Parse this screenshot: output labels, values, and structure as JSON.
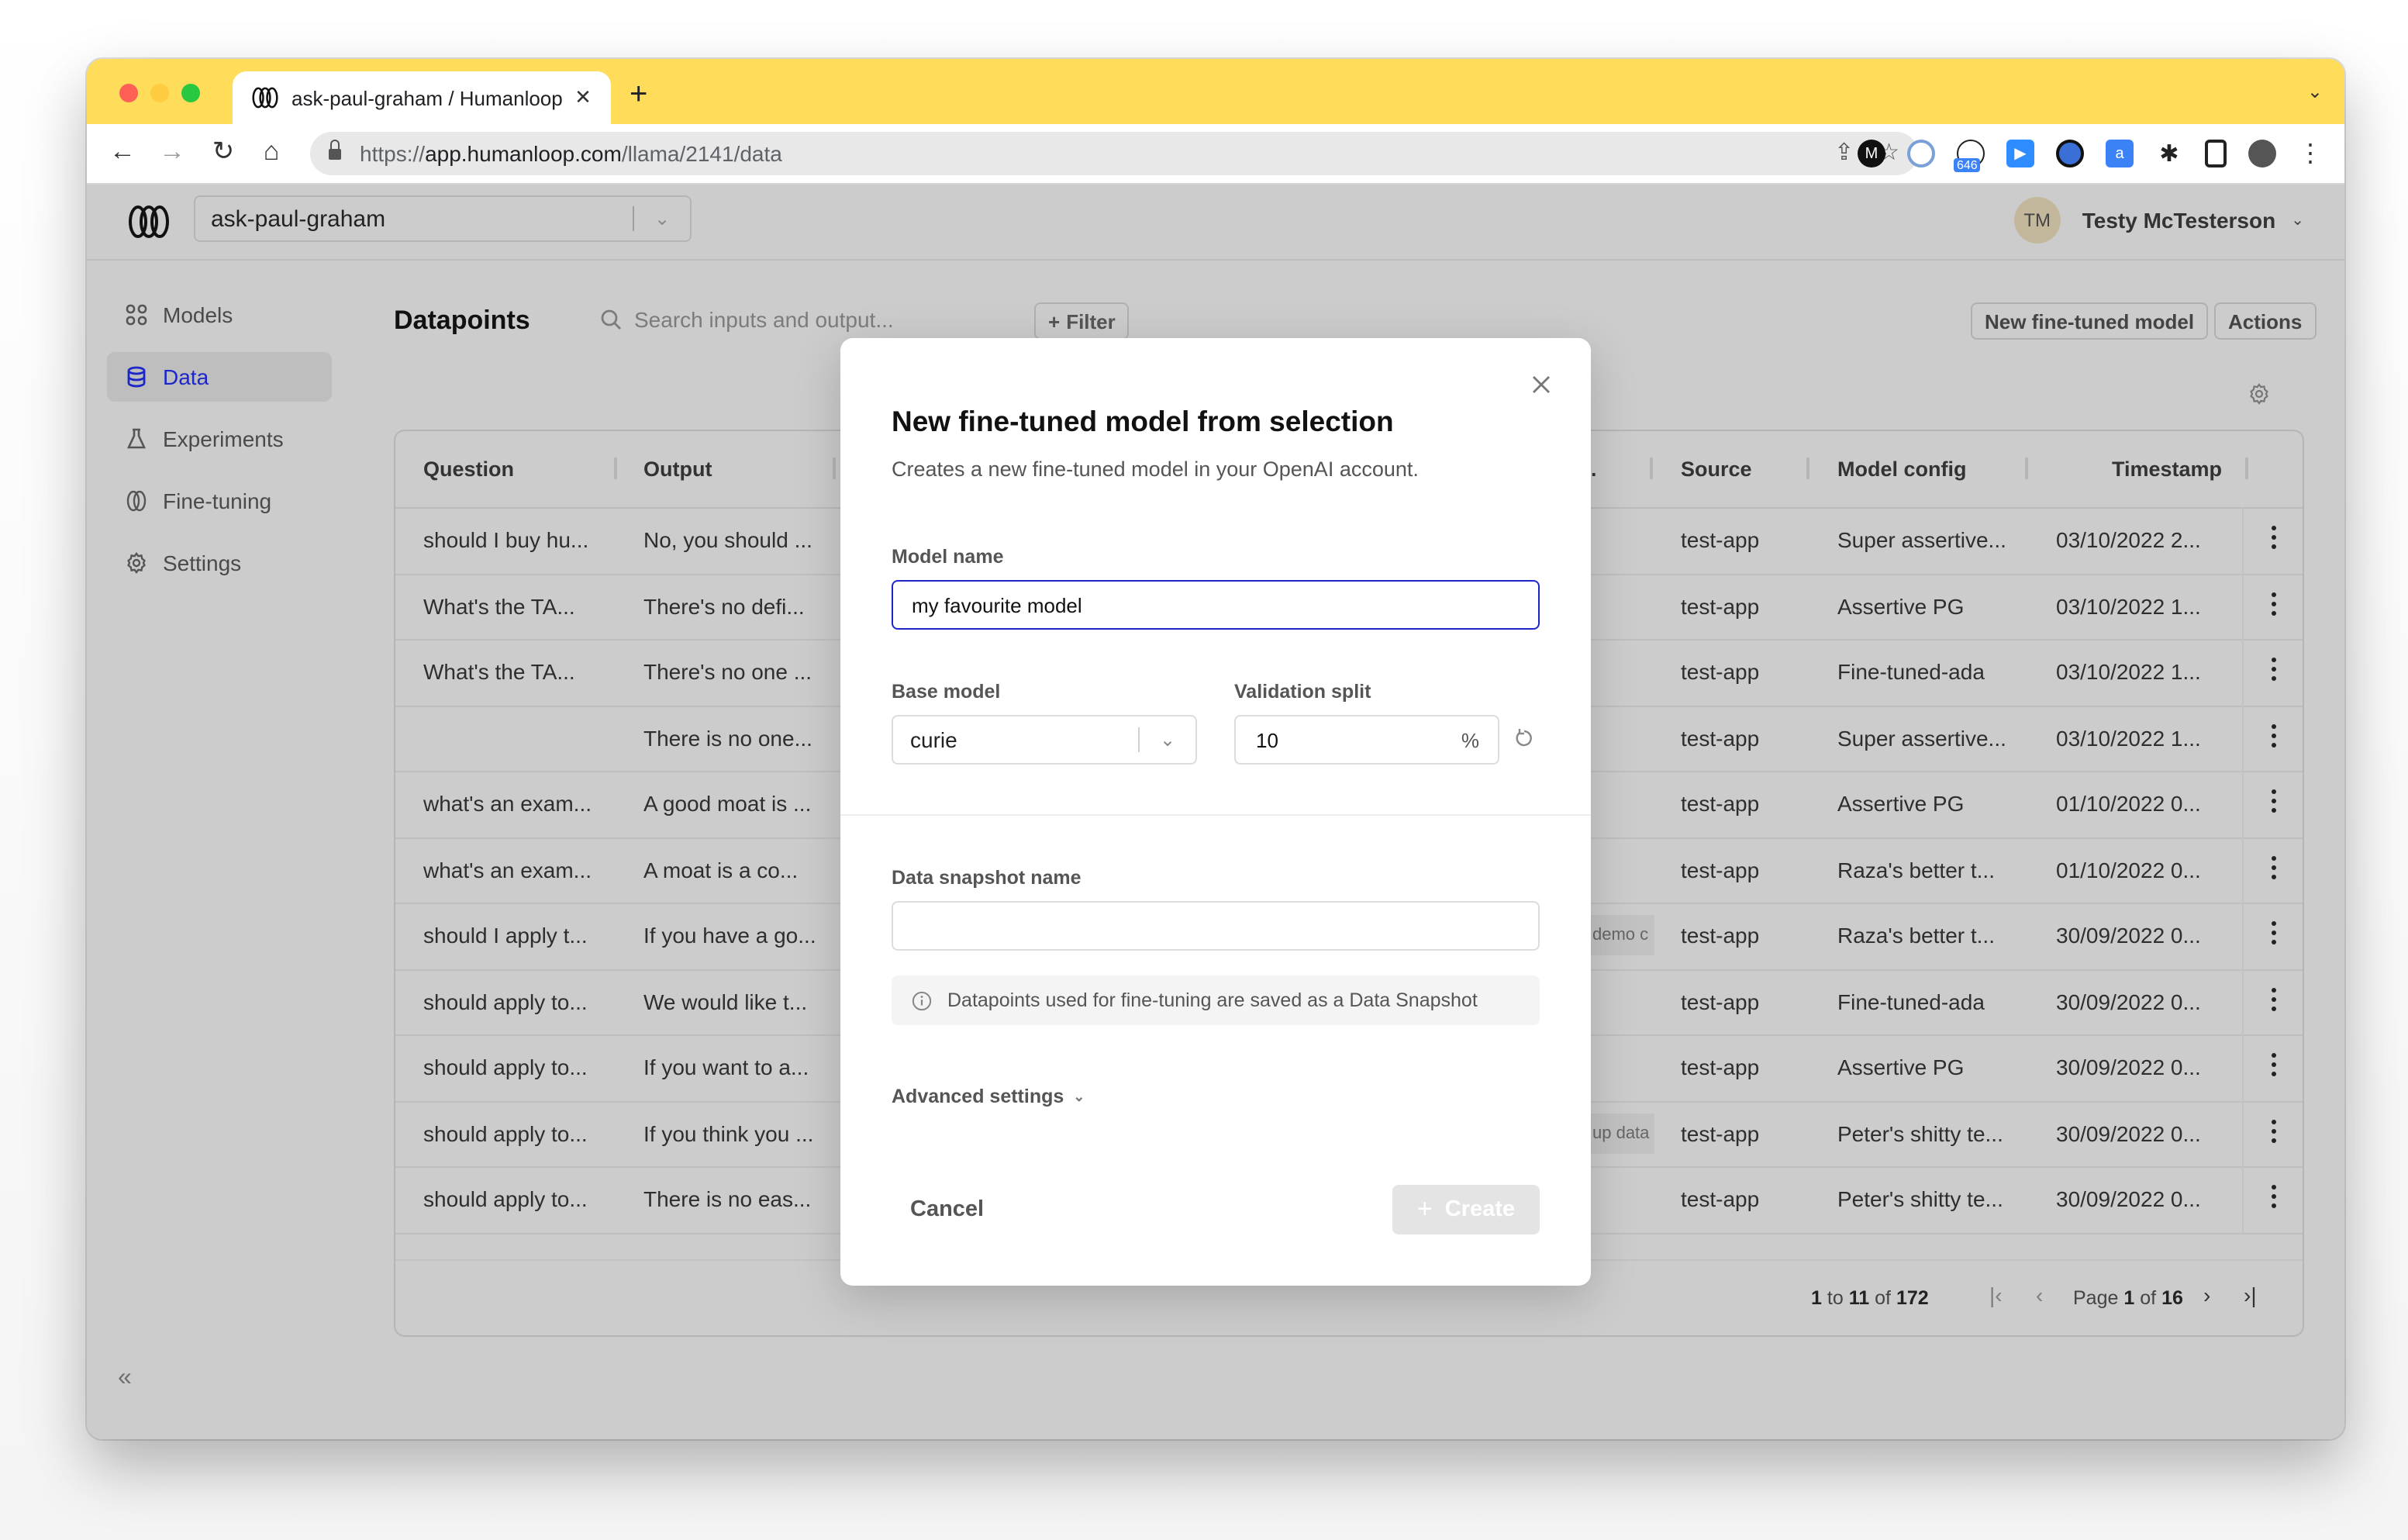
{
  "browser": {
    "tab_title": "ask-paul-graham / Humanloop",
    "tab_close": "✕",
    "new_tab": "+",
    "url_scheme": "https://",
    "url_host": "app.humanloop.com",
    "url_path": "/llama/2141/data",
    "extension_badge": "646"
  },
  "app": {
    "project": "ask-paul-graham",
    "user": {
      "initials": "TM",
      "name": "Testy McTesterson"
    },
    "sidebar": {
      "items": [
        {
          "label": "Models",
          "icon": "grid-icon",
          "active": false
        },
        {
          "label": "Data",
          "icon": "database-icon",
          "active": true
        },
        {
          "label": "Experiments",
          "icon": "flask-icon",
          "active": false
        },
        {
          "label": "Fine-tuning",
          "icon": "fine-tuning-icon",
          "active": false
        },
        {
          "label": "Settings",
          "icon": "gear-icon",
          "active": false
        }
      ],
      "collapse": "«"
    },
    "accent_color": "#1d27c9"
  },
  "page": {
    "title": "Datapoints",
    "search_placeholder": "Search inputs and output...",
    "filter_label": "Filter",
    "new_model_label": "New fine-tuned model",
    "actions_label": "Actions"
  },
  "table": {
    "columns": [
      "Question",
      "Output",
      ".",
      "Source",
      "Model config",
      "Timestamp"
    ],
    "rows": [
      {
        "question": "should I buy hu...",
        "output": "No, you should ...",
        "tag": "",
        "source": "test-app",
        "model_config": "Super assertive...",
        "timestamp": "03/10/2022 2..."
      },
      {
        "question": "What's the TA...",
        "output": "There's no defi...",
        "tag": "",
        "source": "test-app",
        "model_config": "Assertive PG",
        "timestamp": "03/10/2022 1..."
      },
      {
        "question": "What's the TA...",
        "output": "There's no one ...",
        "tag": "",
        "source": "test-app",
        "model_config": "Fine-tuned-ada",
        "timestamp": "03/10/2022 1..."
      },
      {
        "question": "",
        "output": "There is no one...",
        "tag": "",
        "source": "test-app",
        "model_config": "Super assertive...",
        "timestamp": "03/10/2022 1..."
      },
      {
        "question": "what's an exam...",
        "output": "A good moat is ...",
        "tag": "",
        "source": "test-app",
        "model_config": "Assertive PG",
        "timestamp": "01/10/2022 0..."
      },
      {
        "question": "what's an exam...",
        "output": "A moat is a co...",
        "tag": "",
        "source": "test-app",
        "model_config": "Raza's better t...",
        "timestamp": "01/10/2022 0..."
      },
      {
        "question": "should I apply t...",
        "output": "If you have a go...",
        "tag": "demo c",
        "source": "test-app",
        "model_config": "Raza's better t...",
        "timestamp": "30/09/2022 0..."
      },
      {
        "question": "should apply to...",
        "output": "We would like t...",
        "tag": "",
        "source": "test-app",
        "model_config": "Fine-tuned-ada",
        "timestamp": "30/09/2022 0..."
      },
      {
        "question": "should apply to...",
        "output": "If you want to a...",
        "tag": "",
        "source": "test-app",
        "model_config": "Assertive PG",
        "timestamp": "30/09/2022 0..."
      },
      {
        "question": "should apply to...",
        "output": "If you think you ...",
        "tag": "up data",
        "source": "test-app",
        "model_config": "Peter's shitty te...",
        "timestamp": "30/09/2022 0..."
      },
      {
        "question": "should apply to...",
        "output": "There is no eas...",
        "tag": "",
        "source": "test-app",
        "model_config": "Peter's shitty te...",
        "timestamp": "30/09/2022 0..."
      }
    ],
    "pagination": {
      "from": "1",
      "to": "11",
      "total": "172",
      "page": "1",
      "page_count": "16",
      "to_word": "to",
      "of_word": "of",
      "page_word": "Page"
    }
  },
  "modal": {
    "title": "New fine-tuned model from selection",
    "subtitle": "Creates a new fine-tuned model in your OpenAI account.",
    "model_name_label": "Model name",
    "model_name_value": "my favourite model",
    "base_model_label": "Base model",
    "base_model_value": "curie",
    "validation_split_label": "Validation split",
    "validation_split_value": "10",
    "validation_split_unit": "%",
    "snapshot_label": "Data snapshot name",
    "snapshot_value": "",
    "info_text": "Datapoints used for fine-tuning are saved as a Data Snapshot",
    "advanced_label": "Advanced settings",
    "cancel_label": "Cancel",
    "create_label": "Create",
    "create_enabled": false
  }
}
